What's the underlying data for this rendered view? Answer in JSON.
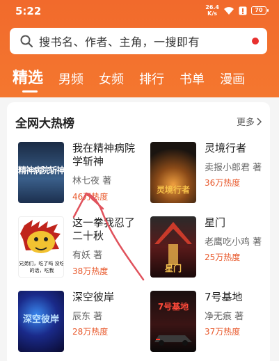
{
  "status_bar": {
    "time": "5:22",
    "net_speed_value": "26.4",
    "net_speed_unit": "K/s",
    "battery": "70"
  },
  "search": {
    "placeholder": "搜书名、作者、主角，一搜即有"
  },
  "tabs": [
    "精选",
    "男频",
    "女频",
    "排行",
    "书单",
    "漫画"
  ],
  "section": {
    "title": "全网大热榜",
    "more_label": "更多"
  },
  "books": [
    {
      "title": "我在精神病院学斩神",
      "author": "林七夜 著",
      "heat": "46万热度",
      "cover_text": "精神病院斩神"
    },
    {
      "title": "灵境行者",
      "author": "卖报小郎君 著",
      "heat": "36万热度",
      "cover_text": "灵境行者"
    },
    {
      "title": "这一拳我忍了二十秋",
      "author": "有妖 著",
      "heat": "38万热度",
      "cover_text": "兄弟们，吃了吗 没吃的话，吃我"
    },
    {
      "title": "星门",
      "author": "老鹰吃小鸡 著",
      "heat": "25万热度",
      "cover_text": "星门"
    },
    {
      "title": "深空彼岸",
      "author": "辰东 著",
      "heat": "28万热度",
      "cover_text": "深空彼岸"
    },
    {
      "title": "7号基地",
      "author": "净无痕 著",
      "heat": "37万热度",
      "cover_text": "7号基地"
    }
  ],
  "colors": {
    "brand": "#f16a2c",
    "heat": "#e8582b",
    "annotation_arrow": "#e0525c"
  }
}
